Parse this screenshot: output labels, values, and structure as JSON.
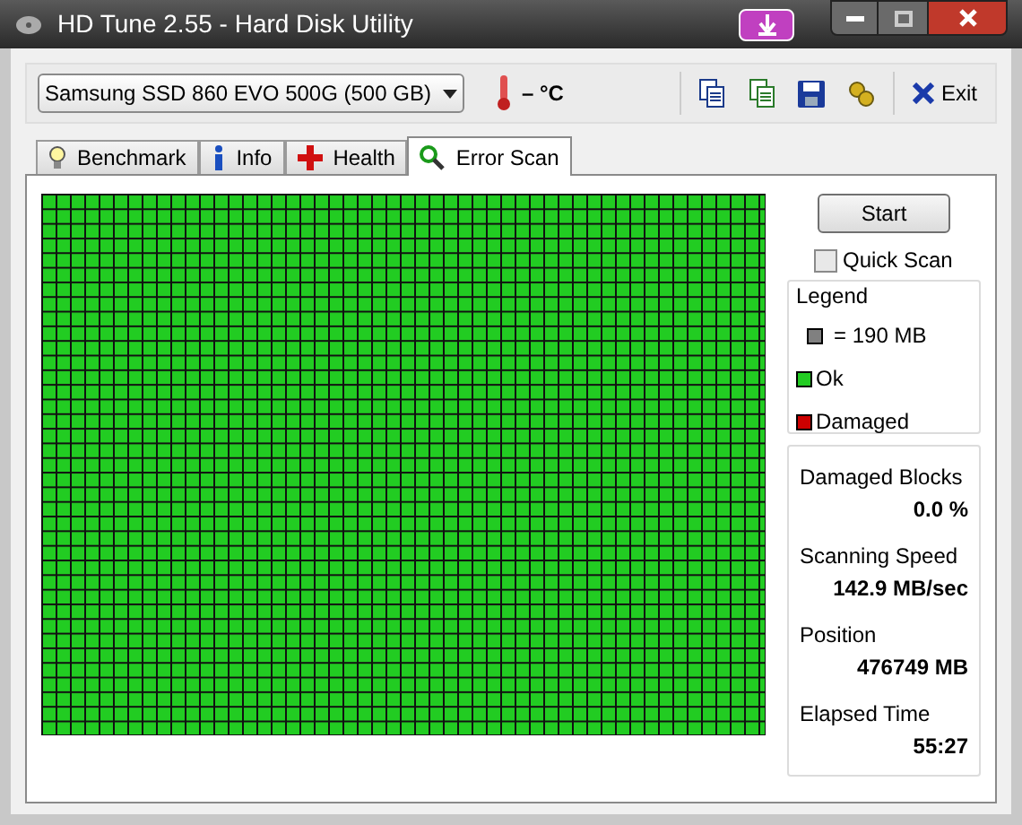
{
  "window": {
    "title": "HD Tune 2.55 - Hard Disk Utility"
  },
  "toolbar": {
    "drive": "Samsung SSD 860 EVO 500G (500 GB)",
    "temperature": "– °C",
    "exit": "Exit"
  },
  "tabs": [
    {
      "label": "Benchmark",
      "selected": false,
      "kind": "bulb"
    },
    {
      "label": "Info",
      "selected": false,
      "kind": "info"
    },
    {
      "label": "Health",
      "selected": false,
      "kind": "health"
    },
    {
      "label": "Error Scan",
      "selected": true,
      "kind": "scan"
    }
  ],
  "scan": {
    "start": "Start",
    "quick_scan": {
      "label": "Quick Scan",
      "checked": false
    },
    "legend": {
      "title": "Legend",
      "items": [
        {
          "label": "= 190 MB",
          "color": "#808080"
        },
        {
          "label": "Ok",
          "color": "#22cc22"
        },
        {
          "label": "Damaged",
          "color": "#cc0000"
        }
      ]
    },
    "stats": [
      {
        "label": "Damaged Blocks",
        "value": "0.0 %"
      },
      {
        "label": "Scanning Speed",
        "value": "142.9 MB/sec"
      },
      {
        "label": "Position",
        "value": "476749 MB"
      },
      {
        "label": "Elapsed Time",
        "value": "55:27"
      }
    ]
  }
}
